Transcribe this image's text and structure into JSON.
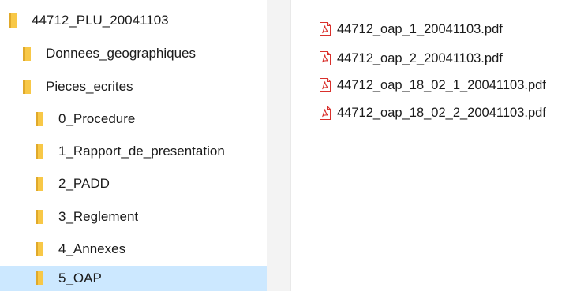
{
  "tree": {
    "items": [
      {
        "label": "44712_PLU_20041103",
        "selected": false
      },
      {
        "label": "Donnees_geographiques",
        "selected": false
      },
      {
        "label": "Pieces_ecrites",
        "selected": false
      },
      {
        "label": "0_Procedure",
        "selected": false
      },
      {
        "label": "1_Rapport_de_presentation",
        "selected": false
      },
      {
        "label": "2_PADD",
        "selected": false
      },
      {
        "label": "3_Reglement",
        "selected": false
      },
      {
        "label": "4_Annexes",
        "selected": false
      },
      {
        "label": "5_OAP",
        "selected": true
      }
    ]
  },
  "files": {
    "items": [
      {
        "name": "44712_oap_1_20041103.pdf",
        "icon": "pdf-icon"
      },
      {
        "name": "44712_oap_2_20041103.pdf",
        "icon": "pdf-icon"
      },
      {
        "name": "44712_oap_18_02_1_20041103.pdf",
        "icon": "pdf-icon"
      },
      {
        "name": "44712_oap_18_02_2_20041103.pdf",
        "icon": "pdf-icon"
      }
    ]
  },
  "colors": {
    "selection": "#cce8ff",
    "folder": "#f8c847",
    "pdf_red": "#d9302c"
  }
}
